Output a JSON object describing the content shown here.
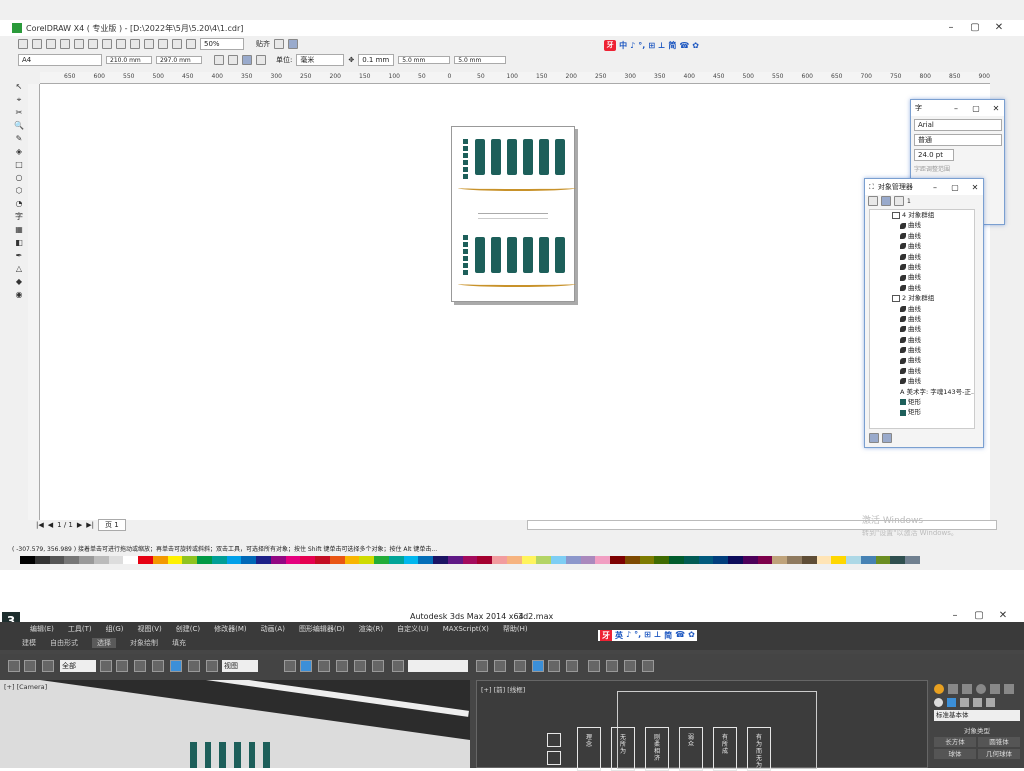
{
  "corel": {
    "title": "CorelDRAW X4 ( 专业版 ) - [D:\\2022年\\5月\\5.20\\4\\1.cdr]",
    "zoom": "50%",
    "snap_label": "贴齐",
    "paper": "A4",
    "width": "210.0 mm",
    "height": "297.0 mm",
    "unit_label": "单位:",
    "unit": "毫米",
    "nudge": "0.1 mm",
    "dup_x": "5.0 mm",
    "dup_y": "5.0 mm",
    "ruler_ticks": [
      "650",
      "600",
      "550",
      "500",
      "450",
      "400",
      "350",
      "300",
      "250",
      "200",
      "150",
      "100",
      "50",
      "0",
      "50",
      "100",
      "150",
      "200",
      "250",
      "300",
      "350",
      "400",
      "450",
      "500",
      "550",
      "600",
      "650",
      "700",
      "750",
      "800",
      "850",
      "900"
    ],
    "page_counter": "1 / 1",
    "page_tab": "页 1",
    "status": "( -307.579, 356.989 )   接着单击可进行拖动或缩放；再单击可旋转或斜斜；双击工具，可选择所有对象；按住 Shift 键单击可选择多个对象；按住 Alt 键单击...",
    "activate_watermark": "激活 Windows",
    "activate_sub": "转到\"设置\"以激活 Windows。"
  },
  "ime": {
    "logo": "牙",
    "items": [
      "中",
      "♪",
      "°,",
      "⊞",
      "⊥",
      "简",
      "☎",
      "✿"
    ]
  },
  "font_panel": {
    "title": "字",
    "font": "Arial",
    "style": "普通",
    "size": "24.0 pt",
    "hint": "字距调整范围"
  },
  "obj_panel": {
    "title": "对象管理器",
    "layer": "1",
    "rows": [
      {
        "type": "group",
        "text": "4 对象群组"
      },
      {
        "type": "curve",
        "text": "曲线"
      },
      {
        "type": "curve",
        "text": "曲线"
      },
      {
        "type": "curve",
        "text": "曲线"
      },
      {
        "type": "curve",
        "text": "曲线"
      },
      {
        "type": "curve",
        "text": "曲线"
      },
      {
        "type": "curve",
        "text": "曲线"
      },
      {
        "type": "curve",
        "text": "曲线"
      },
      {
        "type": "group",
        "text": "2 对象群组"
      },
      {
        "type": "curve",
        "text": "曲线"
      },
      {
        "type": "curve",
        "text": "曲线"
      },
      {
        "type": "curve",
        "text": "曲线"
      },
      {
        "type": "curve",
        "text": "曲线"
      },
      {
        "type": "curve",
        "text": "曲线"
      },
      {
        "type": "curve",
        "text": "曲线"
      },
      {
        "type": "curve",
        "text": "曲线"
      },
      {
        "type": "curve",
        "text": "曲线"
      },
      {
        "type": "text",
        "text": "美术字:  字魂143号-正..."
      },
      {
        "type": "rect",
        "text": "矩形"
      },
      {
        "type": "rect",
        "text": "矩形"
      }
    ]
  },
  "max": {
    "title": "Autodesk 3ds Max  2014 x64",
    "file": "3d2.max",
    "menu": [
      "编辑(E)",
      "工具(T)",
      "组(G)",
      "视图(V)",
      "创建(C)",
      "修改器(M)",
      "动画(A)",
      "图形编辑器(D)",
      "渲染(R)",
      "自定义(U)",
      "MAXScript(X)",
      "帮助(H)"
    ],
    "ribbon": [
      "建模",
      "自由形式",
      "选择",
      "对象绘制",
      "填充"
    ],
    "ribbon_active": "选择",
    "filter": "全部",
    "view": "视图",
    "persp_label": "[+] [Camera]",
    "front_label": "[+] [前] [线框]",
    "cmd_dropdown": "标准基本体",
    "cmd_header": "对象类型",
    "cmd_items": [
      "长方体",
      "圆锥体",
      "球体",
      "几何球体"
    ],
    "front_texts": [
      "理\n念",
      "无\n所\n为",
      "刚\n柔\n相\n济",
      "弱\n众",
      "有\n所\n成",
      "有\n为\n而\n无\n为"
    ]
  },
  "colors": {
    "teal": "#1d5f5a",
    "gold": "#c8922a",
    "ime_blue": "#1a55c0"
  },
  "palette": [
    "#000000",
    "#333333",
    "#555555",
    "#777777",
    "#999999",
    "#bbbbbb",
    "#dddddd",
    "#ffffff",
    "#e60012",
    "#f39800",
    "#fff100",
    "#8fc31f",
    "#009944",
    "#009e96",
    "#00a0e9",
    "#0068b7",
    "#1d2088",
    "#920783",
    "#e4007f",
    "#e5004f",
    "#c30d23",
    "#e95513",
    "#f8b500",
    "#cfdb00",
    "#22ac38",
    "#00a497",
    "#00b7ee",
    "#036eb8",
    "#1b1464",
    "#601986",
    "#a40b5d",
    "#a4002f",
    "#f29c9f",
    "#f6b37f",
    "#fff45c",
    "#b3d465",
    "#7ecef4",
    "#8c97cb",
    "#aa89bd",
    "#f19ec2",
    "#7d0000",
    "#7d4900",
    "#7d7b00",
    "#3f6b00",
    "#005c2c",
    "#005b54",
    "#005a7d",
    "#003e7d",
    "#0b0b5a",
    "#4c005a",
    "#7d004b",
    "#bfa37b",
    "#8f7a5f",
    "#5f4d36",
    "#ffe4b5",
    "#ffd700",
    "#add8e6",
    "#4682b4",
    "#6b8e23",
    "#2f4f4f",
    "#708090"
  ]
}
